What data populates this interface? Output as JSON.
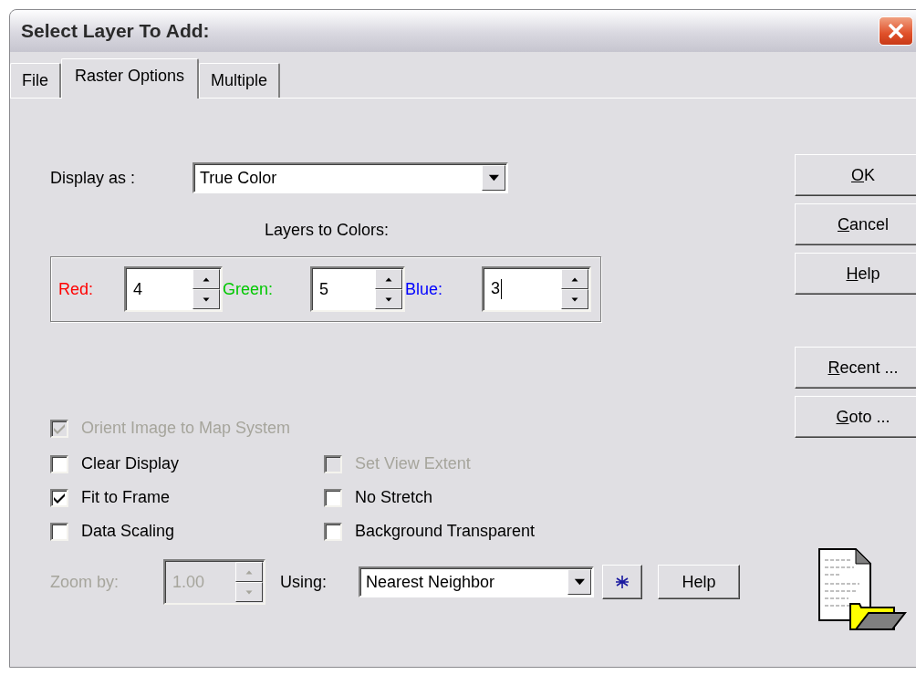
{
  "window": {
    "title": "Select Layer To Add:"
  },
  "tabs": [
    {
      "label": "File",
      "selected": false
    },
    {
      "label": "Raster Options",
      "selected": true
    },
    {
      "label": "Multiple",
      "selected": false
    }
  ],
  "display_as": {
    "label": "Display as :",
    "value": "True Color"
  },
  "layers_to_colors": {
    "title": "Layers to Colors:",
    "channels": [
      {
        "label": "Red:",
        "value": "4",
        "color": "#ff0000",
        "focused": false
      },
      {
        "label": "Green:",
        "value": "5",
        "color": "#00c800",
        "focused": false
      },
      {
        "label": "Blue:",
        "value": "3",
        "color": "#0000ff",
        "focused": true
      }
    ]
  },
  "orient_option": {
    "label": "Orient Image to Map System",
    "checked": true,
    "disabled": true
  },
  "options": [
    {
      "label": "Clear Display",
      "checked": false,
      "disabled": false
    },
    {
      "label": "Set View Extent",
      "checked": false,
      "disabled": true
    },
    {
      "label": "Fit to Frame",
      "checked": true,
      "disabled": false
    },
    {
      "label": "No Stretch",
      "checked": false,
      "disabled": false
    },
    {
      "label": "Data Scaling",
      "checked": false,
      "disabled": false
    },
    {
      "label": "Background Transparent",
      "checked": false,
      "disabled": false
    }
  ],
  "zoom": {
    "label": "Zoom by:",
    "value": "1.00",
    "disabled": true
  },
  "resampling": {
    "label": "Using:",
    "value": "Nearest Neighbor",
    "help": "Help"
  },
  "buttons": [
    {
      "label": "OK",
      "first_letter_underlined": true
    },
    {
      "label": "Cancel",
      "first_letter_underlined": true
    },
    {
      "label": "Help",
      "first_letter_underlined": true
    }
  ],
  "nav_buttons": [
    {
      "label": "Recent ...",
      "first_letter_underlined": true
    },
    {
      "label": "Goto ...",
      "first_letter_underlined": true
    }
  ]
}
